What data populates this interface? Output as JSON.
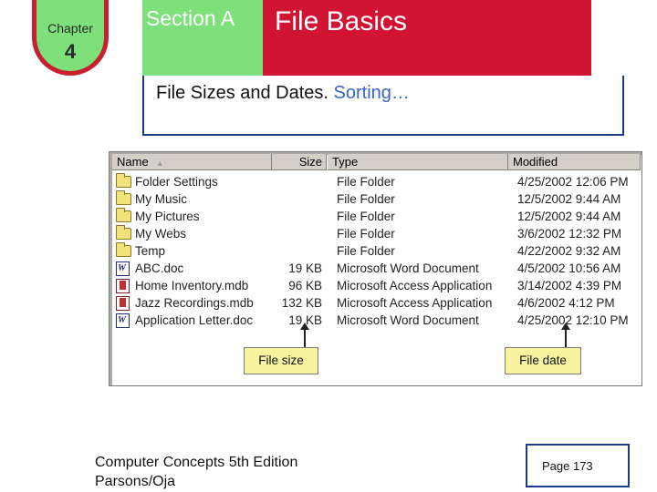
{
  "chapter": {
    "label": "Chapter",
    "number": "4"
  },
  "header": {
    "section": "Section A",
    "title": "File Basics"
  },
  "subtitle": {
    "main": "File Sizes and Dates.",
    "accent": "Sorting…"
  },
  "explorer": {
    "columns": {
      "name": "Name",
      "size": "Size",
      "type": "Type",
      "modified": "Modified"
    },
    "rows": [
      {
        "icon": "folder-icon",
        "name": "Folder Settings",
        "size": "",
        "type": "File Folder",
        "modified": "4/25/2002 12:06 PM"
      },
      {
        "icon": "folder-icon",
        "name": "My Music",
        "size": "",
        "type": "File Folder",
        "modified": "12/5/2002 9:44 AM"
      },
      {
        "icon": "folder-icon",
        "name": "My Pictures",
        "size": "",
        "type": "File Folder",
        "modified": "12/5/2002 9:44 AM"
      },
      {
        "icon": "folder-icon",
        "name": "My Webs",
        "size": "",
        "type": "File Folder",
        "modified": "3/6/2002 12:32 PM"
      },
      {
        "icon": "folder-icon",
        "name": "Temp",
        "size": "",
        "type": "File Folder",
        "modified": "4/22/2002 9:32 AM"
      },
      {
        "icon": "word-doc-icon",
        "name": "ABC.doc",
        "size": "19 KB",
        "type": "Microsoft Word Document",
        "modified": "4/5/2002 10:56 AM"
      },
      {
        "icon": "access-db-icon",
        "name": "Home Inventory.mdb",
        "size": "96 KB",
        "type": "Microsoft Access Application",
        "modified": "3/14/2002 4:39 PM"
      },
      {
        "icon": "access-db-icon",
        "name": "Jazz Recordings.mdb",
        "size": "132 KB",
        "type": "Microsoft Access Application",
        "modified": "4/6/2002 4:12 PM"
      },
      {
        "icon": "word-doc-icon",
        "name": "Application Letter.doc",
        "size": "19 KB",
        "type": "Microsoft Word Document",
        "modified": "4/25/2002 12:10 PM"
      }
    ],
    "callouts": {
      "size": "File size",
      "date": "File date"
    }
  },
  "footer": {
    "line1": "Computer Concepts 5th Edition",
    "line2": "Parsons/Oja",
    "page": "Page 173"
  },
  "colors": {
    "green": "#7ee07b",
    "red": "#d21434",
    "border_blue": "#1f3a8a",
    "accent_blue": "#3366cc",
    "callout_yellow": "#f7f3a0"
  }
}
